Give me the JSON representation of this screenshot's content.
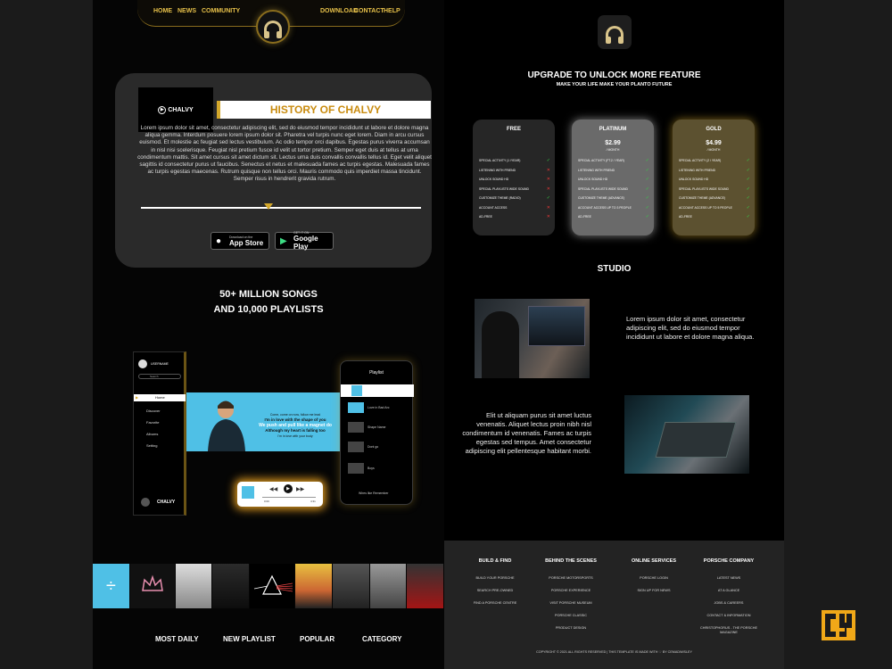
{
  "nav": {
    "left": [
      "HOME",
      "NEWS",
      "COMMUNITY"
    ],
    "right": [
      "DOWNLOAD",
      "CONTACT",
      "HELP"
    ]
  },
  "history": {
    "logo_text": "CHALVY",
    "title": "HISTORY OF CHALVY",
    "body": "Lorem ipsum dolor sit amet, consectetur adipiscing elit, sed do eiusmod tempor incididunt ut labore et dolore magna aliqua gemma. Interdum posuere lorem ipsum dolor sit. Pharetra vel turpis nunc eget lorem. Diam in arcu cursus euismod. Et molestie ac feugiat sed lectus vestibulum. Ac odio tempor orci dapibus. Egestas purus viverra accumsan in nisl nisi scelerisque. Feugiat nisl pretium fusce id velit ut tortor pretium. Semper eget duis at tellus at urna condimentum mattis. Sit amet cursus sit amet dictum sit. Lectus urna duis convallis convallis tellus id. Eget velit aliquet sagittis id consectetur purus ut faucibus. Senectus et netus et malesuada fames ac turpis egestas. Malesuada fames ac turpis egestas maecenas. Rutrum quisque non tellus orci. Mauris commodo quis imperdiet massa tincidunt. Semper risus in hendrerit gravida rutrum.",
    "appstore_small": "Download on the",
    "appstore_big": "App Store",
    "googleplay_small": "GET IT ON",
    "googleplay_big": "Google Play"
  },
  "songs": {
    "line1": "50+ MILLION SONGS",
    "line2": "AND 10,000 PLAYLISTS"
  },
  "app_mock": {
    "username": "USERNAME",
    "search": "Search",
    "menu": [
      "Home",
      "Discover",
      "Favorite",
      "Albums",
      "Setting"
    ],
    "brand": "CHALVY",
    "lyrics": [
      "Come, come on now, follow me lead",
      "I'm in love with the shape of you",
      "We push and pull like a magnet do",
      "Although my heart is falling too",
      "I'm in love with your body"
    ],
    "playlist_title": "Playlist",
    "playlist_items": [
      "Love in Bad Arc",
      "Shape Name",
      "Dont go",
      "Boys",
      "Wires like Remember"
    ],
    "time_start": "0:00",
    "time_end": "4:31"
  },
  "bottom_nav": [
    "MOST DAILY",
    "NEW PLAYLIST",
    "POPULAR",
    "CATEGORY"
  ],
  "upgrade": {
    "title": "UPGRADE TO UNLOCK MORE FEATURE",
    "subtitle": "MAKE YOUR LIFE MAKE YOUR PLANTO FUTURE",
    "plans": [
      {
        "name": "FREE",
        "price": "",
        "per": "",
        "bg": "#262626",
        "features": [
          "SPECIAL ACTIVITY (1 /YEAR)",
          "LISTENING WITH FRIEND",
          "UNLOCK SOUND HD",
          "SPECIAL PLAYLISTS WIDE SOUND",
          "CUSTOMIZE THEME (RADIO)",
          "ACCOUNT ACCESS",
          "AD-FREE"
        ],
        "marks": [
          "check",
          "x",
          "x",
          "x",
          "check",
          "x",
          "x"
        ]
      },
      {
        "name": "PLATINUM",
        "price": "$2.99",
        "per": "/ MONTH",
        "bg": "#6a6a6a",
        "features": [
          "SPECIAL ACTIVITY (FT.2 / YEAR)",
          "LISTENING WITH FRIEND",
          "UNLOCK SOUND HD",
          "SPECIAL PLAYLISTS WIDE SOUND",
          "CUSTOMIZE THEME (ADVANCE)",
          "ACCOUNT ACCESS UP TO 3 PEOPLE",
          "AD-FREE"
        ],
        "marks": [
          "check",
          "check",
          "check",
          "check",
          "check",
          "check",
          "check"
        ]
      },
      {
        "name": "GOLD",
        "price": "$4.99",
        "per": "/ MONTH",
        "bg": "#5c5130",
        "features": [
          "SPECIAL ACTIVITY (2 / YEAR)",
          "LISTENING WITH FRIEND",
          "UNLOCK SOUND HD",
          "SPECIAL PLAYLISTS WIDE SOUND",
          "CUSTOMIZE THEME (ADVANCE)",
          "ACCOUNT ACCESS UP TO 5 PEOPLE",
          "AD-FREE"
        ],
        "marks": [
          "check",
          "check",
          "check",
          "check",
          "check",
          "check",
          "check"
        ]
      }
    ]
  },
  "studio": {
    "title": "STUDIO",
    "p1": "Lorem ipsum dolor sit amet, consectetur adipiscing elit, sed do eiusmod tempor incididunt ut labore et dolore magna aliqua.",
    "p2": "Elit ut aliquam purus sit amet luctus venenatis. Aliquet lectus proin nibh nisl condimentum id venenatis. Fames ac turpis egestas sed tempus. Amet consectetur adipiscing elit pellentesque habitant morbi."
  },
  "footer": {
    "columns": [
      {
        "head": "BUILD & FIND",
        "links": [
          "BUILD YOUR PORSCHE",
          "SEARCH PRE-OWNED",
          "FIND A PORSCHE CENTRE"
        ]
      },
      {
        "head": "BEHIND THE SCENES",
        "links": [
          "PORSCHE MOTORSPORTS",
          "PORSCHE EXPERIENCE",
          "VISIT PORSCHE MUSEUM",
          "PORSCHE CLASSIC",
          "PRODUCT DESIGN"
        ]
      },
      {
        "head": "ONLINE SERVICES",
        "links": [
          "PORSCHE LOGIN",
          "SIGN UP FOR NEWS"
        ]
      },
      {
        "head": "PORSCHE COMPANY",
        "links": [
          "LATEST NEWS",
          "AT A GLANCE",
          "JOBS & CAREERS",
          "CONTACT & INFORMATION",
          "CHRISTOPHORUS - THE PORSCHE MAGAZINE"
        ]
      }
    ],
    "copyright": "COPYRIGHT © 2021 ALL RIGHTS RESERVED | THIS TEMPLATE IS MADE WITH ♡ BY CEMADWISLEY"
  },
  "colors": {
    "gold": "#d4a82b",
    "brand_orange": "#f0a818"
  }
}
